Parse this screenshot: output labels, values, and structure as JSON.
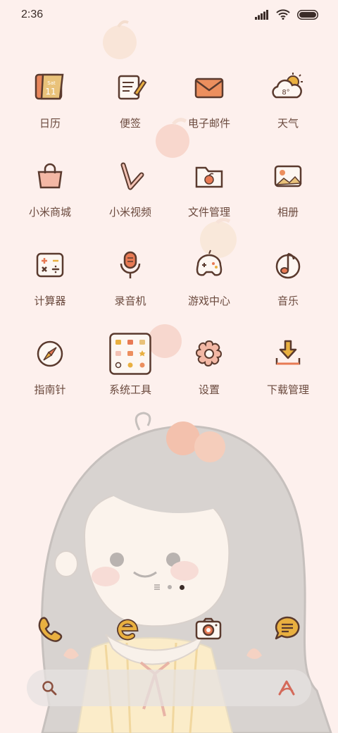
{
  "status": {
    "time": "2:36"
  },
  "apps": [
    {
      "label": "日历",
      "icon": "calendar-icon",
      "day": "Sat",
      "date": "11"
    },
    {
      "label": "便签",
      "icon": "notes-icon"
    },
    {
      "label": "电子邮件",
      "icon": "email-icon"
    },
    {
      "label": "天气",
      "icon": "weather-icon",
      "temp": "8°"
    },
    {
      "label": "小米商城",
      "icon": "shopping-bag-icon"
    },
    {
      "label": "小米视频",
      "icon": "video-play-icon"
    },
    {
      "label": "文件管理",
      "icon": "folder-icon"
    },
    {
      "label": "相册",
      "icon": "gallery-icon"
    },
    {
      "label": "计算器",
      "icon": "calculator-icon"
    },
    {
      "label": "录音机",
      "icon": "microphone-icon"
    },
    {
      "label": "游戏中心",
      "icon": "game-controller-icon"
    },
    {
      "label": "音乐",
      "icon": "music-note-icon"
    },
    {
      "label": "指南针",
      "icon": "compass-icon"
    },
    {
      "label": "系统工具",
      "icon": "tools-folder-icon"
    },
    {
      "label": "设置",
      "icon": "settings-gear-icon"
    },
    {
      "label": "下载管理",
      "icon": "download-icon"
    }
  ],
  "pager": {
    "pages": 2,
    "active": 2
  },
  "dock": [
    {
      "icon": "phone-icon"
    },
    {
      "icon": "browser-icon"
    },
    {
      "icon": "camera-icon"
    },
    {
      "icon": "messages-icon"
    }
  ],
  "colors": {
    "background": "#fdf0ed",
    "label": "#6b4a3e",
    "accent": "#e9b040",
    "icon_stroke": "#5a3a2e"
  }
}
